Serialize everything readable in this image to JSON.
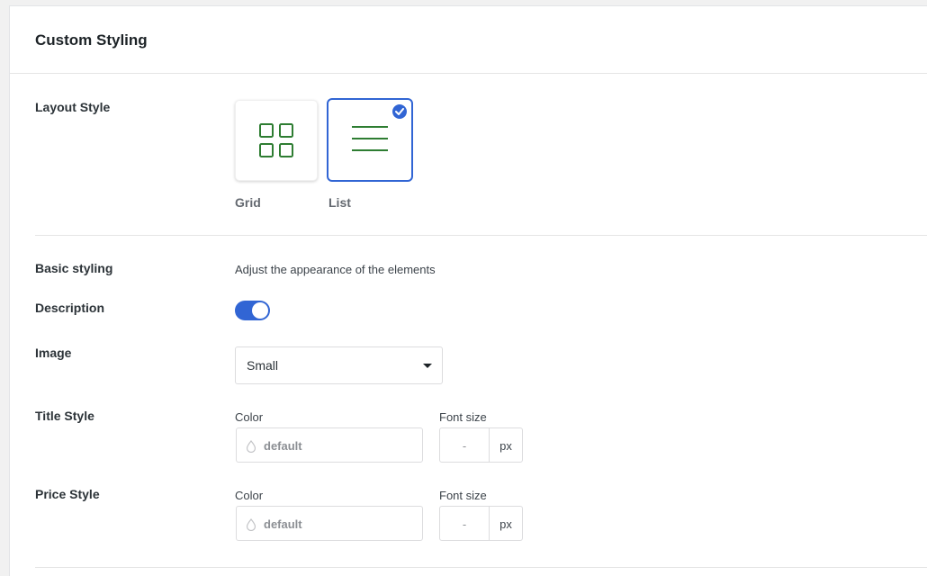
{
  "panel": {
    "title": "Custom Styling"
  },
  "layout_style": {
    "label": "Layout Style",
    "options": [
      {
        "label": "Grid",
        "icon": "grid-icon",
        "selected": false
      },
      {
        "label": "List",
        "icon": "list-icon",
        "selected": true
      }
    ],
    "icon_color": "#2e7d32",
    "accent_color": "#3165d4"
  },
  "basic_styling": {
    "label": "Basic styling",
    "helper": "Adjust the appearance of the elements"
  },
  "description": {
    "label": "Description",
    "enabled": true
  },
  "image": {
    "label": "Image",
    "value": "Small"
  },
  "title_style": {
    "label": "Title Style",
    "color_label": "Color",
    "color_value": "default",
    "font_size_label": "Font size",
    "font_size_value": "-",
    "unit": "px"
  },
  "price_style": {
    "label": "Price Style",
    "color_label": "Color",
    "color_value": "default",
    "font_size_label": "Font size",
    "font_size_value": "-",
    "unit": "px"
  }
}
